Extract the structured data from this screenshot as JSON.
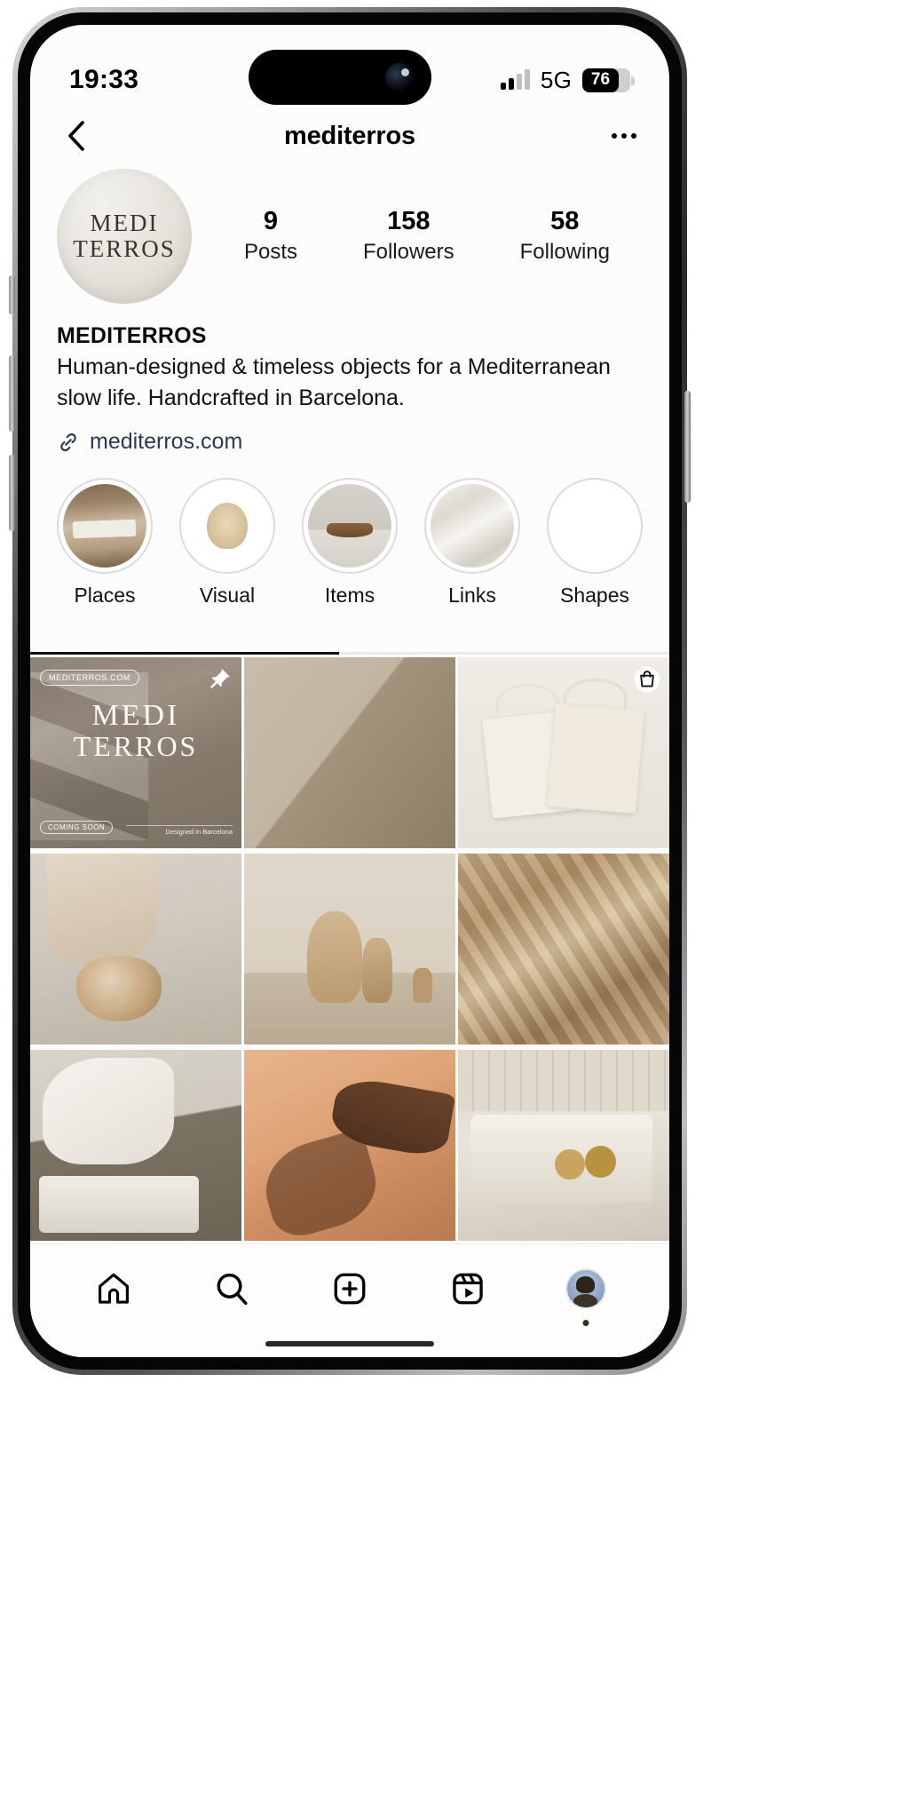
{
  "status_bar": {
    "time": "19:33",
    "network": "5G",
    "battery_percent": "76",
    "signal_icon": "signal-bars-icon",
    "battery_icon": "battery-icon"
  },
  "header": {
    "back_icon": "chevron-left-icon",
    "title": "mediterros",
    "more_icon": "ellipsis-icon"
  },
  "profile": {
    "avatar_icon": "profile-avatar",
    "avatar_logo_line1": "MEDI",
    "avatar_logo_line2": "TERROS",
    "stats": [
      {
        "value": "9",
        "label": "Posts"
      },
      {
        "value": "158",
        "label": "Followers"
      },
      {
        "value": "58",
        "label": "Following"
      }
    ],
    "display_name": "MEDITERROS",
    "bio": "Human-designed & timeless objects for a Mediterranean slow life. Handcrafted in Barcelona.",
    "link_icon": "link-chain-icon",
    "link_text": "mediterros.com",
    "link_color": "#2b3a52"
  },
  "highlights": [
    {
      "label": "Places",
      "art": "hl-places"
    },
    {
      "label": "Visual",
      "art": "hl-visual"
    },
    {
      "label": "Items",
      "art": "hl-items"
    },
    {
      "label": "Links",
      "art": "hl-links"
    },
    {
      "label": "Shapes",
      "art": "hl-shapes"
    }
  ],
  "posts": {
    "tile1": {
      "badge": "MEDITERROS.COM",
      "logo_line1": "MEDI",
      "logo_line2": "TERROS",
      "coming_soon": "COMING SOON",
      "designed_note": "Designed in Barcelona",
      "pin_icon": "pin-icon"
    },
    "tile3": {
      "shop_icon": "shopping-bag-icon"
    }
  },
  "tab_bar": {
    "items": [
      {
        "name": "home",
        "icon": "home-icon"
      },
      {
        "name": "search",
        "icon": "search-icon"
      },
      {
        "name": "create",
        "icon": "plus-square-icon"
      },
      {
        "name": "reels",
        "icon": "reels-icon"
      },
      {
        "name": "profile",
        "icon": "profile-avatar-icon"
      }
    ]
  }
}
